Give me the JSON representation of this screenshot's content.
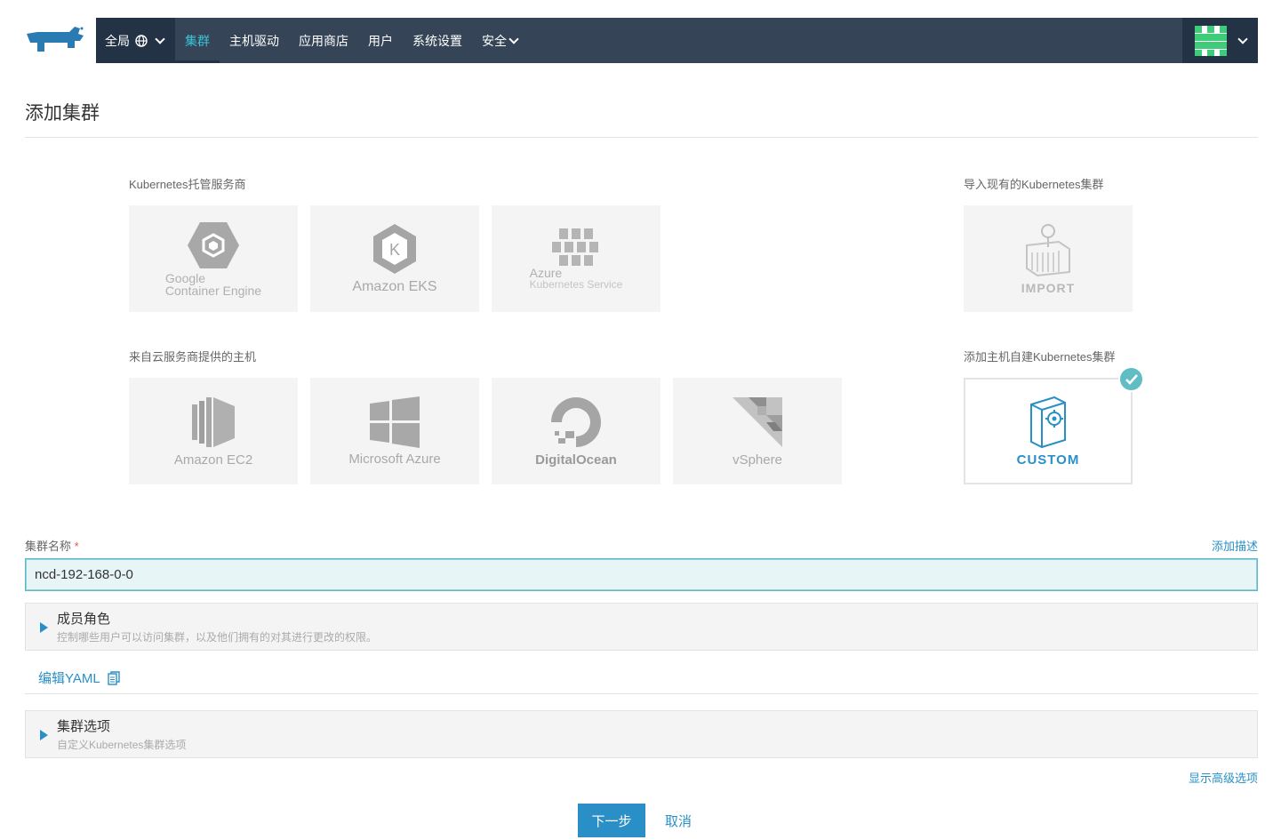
{
  "nav": {
    "global_label": "全局",
    "items": [
      "集群",
      "主机驱动",
      "应用商店",
      "用户",
      "系统设置",
      "安全"
    ],
    "accent_color": "#3cc3d8",
    "bar_color": "#354457"
  },
  "page": {
    "title": "添加集群"
  },
  "sections": {
    "hosted": {
      "label": "Kubernetes托管服务商",
      "cards": [
        {
          "name": "google",
          "line1": "Google",
          "line2": "Container Engine"
        },
        {
          "name": "eks",
          "line1": "Amazon EKS"
        },
        {
          "name": "azure-aks",
          "line1": "Azure",
          "line2": "Kubernetes Service"
        }
      ]
    },
    "import": {
      "label": "导入现有的Kubernetes集群",
      "card_label": "IMPORT"
    },
    "infra": {
      "label": "来自云服务商提供的主机",
      "cards": [
        "Amazon EC2",
        "Microsoft Azure",
        "DigitalOcean",
        "vSphere"
      ]
    },
    "custom": {
      "label": "添加主机自建Kubernetes集群",
      "card_label": "CUSTOM",
      "selected": true
    }
  },
  "form": {
    "name_label": "集群名称",
    "required_mark": "*",
    "add_description": "添加描述",
    "name_value": "ncd-192-168-0-0"
  },
  "members": {
    "title": "成员角色",
    "subtitle": "控制哪些用户可以访问集群，以及他们拥有的对其进行更改的权限。"
  },
  "yaml": {
    "label": "编辑YAML"
  },
  "cluster_options": {
    "title": "集群选项",
    "subtitle": "自定义Kubernetes集群选项"
  },
  "advanced": {
    "label": "显示高级选项"
  },
  "buttons": {
    "next": "下一步",
    "cancel": "取消"
  }
}
